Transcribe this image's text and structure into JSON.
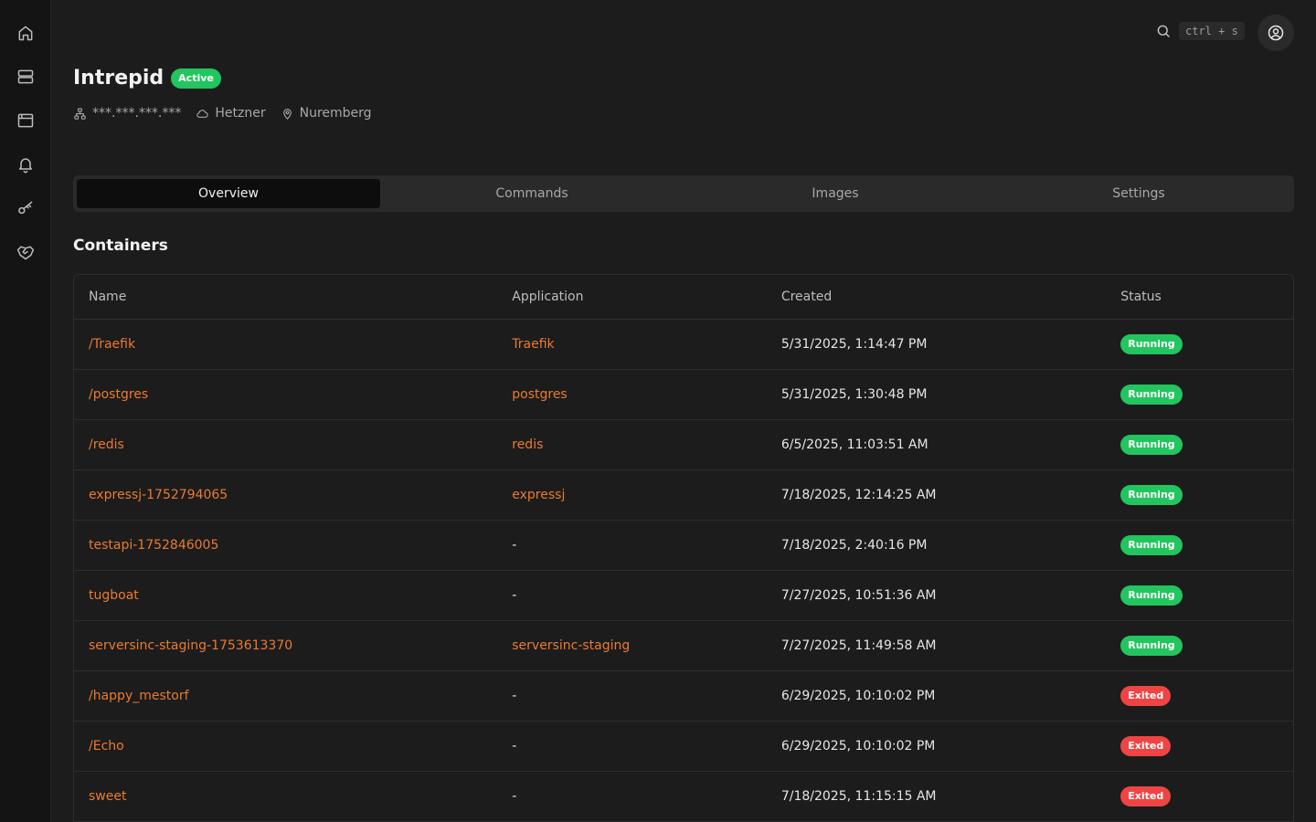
{
  "sidebar": {
    "items": [
      {
        "icon": "home-icon"
      },
      {
        "icon": "servers-icon"
      },
      {
        "icon": "browser-window-icon"
      },
      {
        "icon": "bell-icon"
      },
      {
        "icon": "key-icon"
      },
      {
        "icon": "handshake-icon"
      }
    ]
  },
  "topbar": {
    "search_shortcut": "ctrl + s",
    "search_icon": "search-icon",
    "avatar_icon": "user-circle-icon"
  },
  "server": {
    "name": "Intrepid",
    "status": "Active",
    "ip": "***.***.***.***",
    "provider": "Hetzner",
    "location": "Nuremberg"
  },
  "tabs": [
    {
      "label": "Overview",
      "active": true
    },
    {
      "label": "Commands",
      "active": false
    },
    {
      "label": "Images",
      "active": false
    },
    {
      "label": "Settings",
      "active": false
    }
  ],
  "containers": {
    "title": "Containers",
    "columns": [
      "Name",
      "Application",
      "Created",
      "Status"
    ],
    "rows": [
      {
        "name": "/Traefik",
        "application": "Traefik",
        "created": "5/31/2025, 1:14:47 PM",
        "status": "Running"
      },
      {
        "name": "/postgres",
        "application": "postgres",
        "created": "5/31/2025, 1:30:48 PM",
        "status": "Running"
      },
      {
        "name": "/redis",
        "application": "redis",
        "created": "6/5/2025, 11:03:51 AM",
        "status": "Running"
      },
      {
        "name": "expressj-1752794065",
        "application": "expressj",
        "created": "7/18/2025, 12:14:25 AM",
        "status": "Running"
      },
      {
        "name": "testapi-1752846005",
        "application": "-",
        "created": "7/18/2025, 2:40:16 PM",
        "status": "Running"
      },
      {
        "name": "tugboat",
        "application": "-",
        "created": "7/27/2025, 10:51:36 AM",
        "status": "Running"
      },
      {
        "name": "serversinc-staging-1753613370",
        "application": "serversinc-staging",
        "created": "7/27/2025, 11:49:58 AM",
        "status": "Running"
      },
      {
        "name": "/happy_mestorf",
        "application": "-",
        "created": "6/29/2025, 10:10:02 PM",
        "status": "Exited"
      },
      {
        "name": "/Echo",
        "application": "-",
        "created": "6/29/2025, 10:10:02 PM",
        "status": "Exited"
      },
      {
        "name": "sweet",
        "application": "-",
        "created": "7/18/2025, 11:15:15 AM",
        "status": "Exited"
      }
    ]
  },
  "colors": {
    "accent": "#ea7a32",
    "running": "#22c55e",
    "exited": "#ef4444",
    "active": "#22c55e"
  }
}
